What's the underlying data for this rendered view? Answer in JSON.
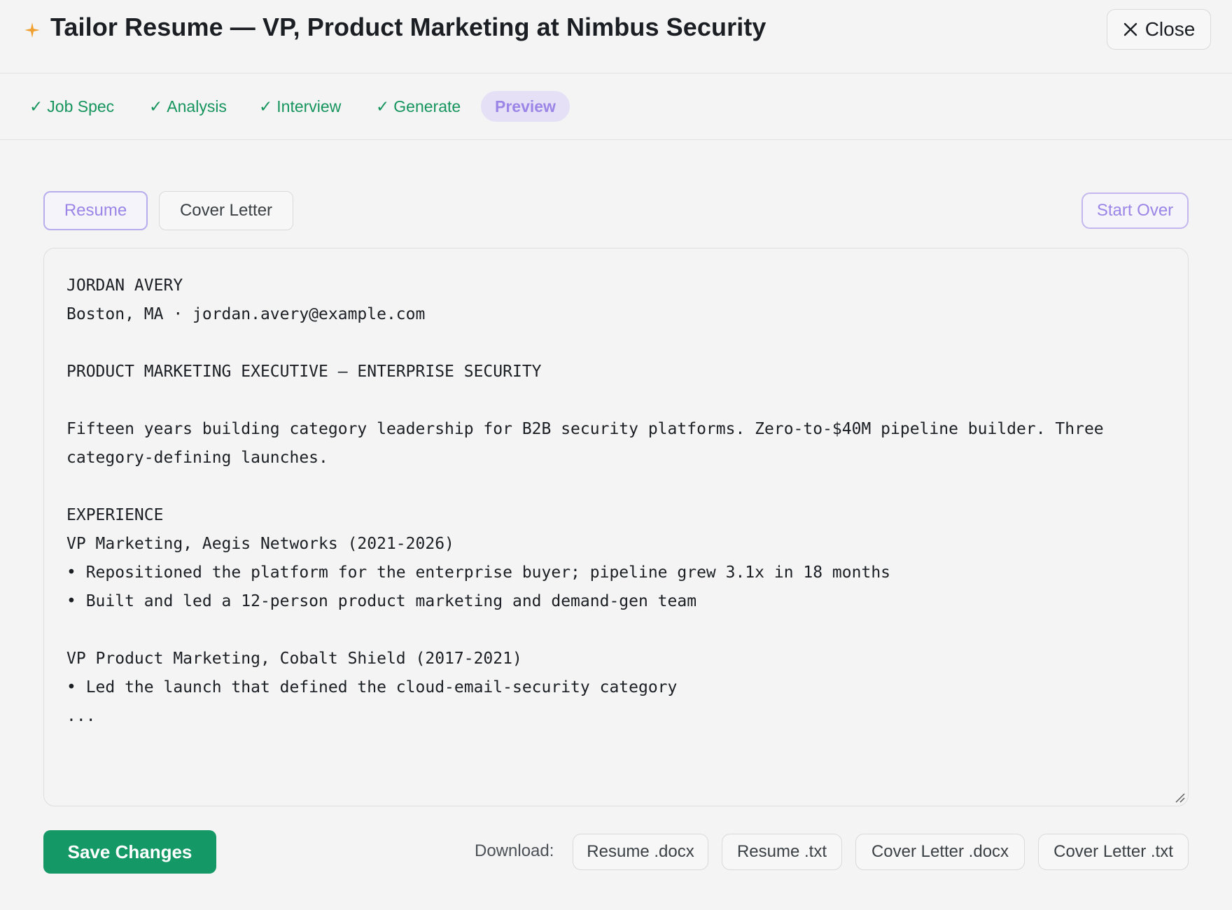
{
  "header": {
    "title": "Tailor Resume — VP, Product Marketing at Nimbus Security",
    "close_label": "Close"
  },
  "steps": [
    {
      "label": "Job Spec",
      "status": "done"
    },
    {
      "label": "Analysis",
      "status": "done"
    },
    {
      "label": "Interview",
      "status": "done"
    },
    {
      "label": "Generate",
      "status": "done"
    },
    {
      "label": "Preview",
      "status": "active"
    }
  ],
  "step_check": "✓",
  "tabs": {
    "resume": "Resume",
    "cover_letter": "Cover Letter",
    "active": "Resume"
  },
  "start_over_label": "Start Over",
  "editor": {
    "lines": [
      "JORDAN AVERY",
      "Boston, MA · jordan.avery@example.com",
      "",
      "PRODUCT MARKETING EXECUTIVE — ENTERPRISE SECURITY",
      "",
      "Fifteen years building category leadership for B2B security platforms. Zero-to-$40M pipeline builder. Three",
      "category-defining launches.",
      "",
      "EXPERIENCE",
      "VP Marketing, Aegis Networks (2021-2026)",
      "• Repositioned the platform for the enterprise buyer; pipeline grew 3.1x in 18 months",
      "• Built and led a 12-person product marketing and demand-gen team",
      "",
      "VP Product Marketing, Cobalt Shield (2017-2021)",
      "• Led the launch that defined the cloud-email-security category",
      "..."
    ]
  },
  "footer": {
    "save_label": "Save Changes",
    "download_label": "Download:",
    "downloads": [
      "Resume .docx",
      "Resume .txt",
      "Cover Letter .docx",
      "Cover Letter .txt"
    ]
  },
  "colors": {
    "accent_purple": "#9b85e6",
    "success_green": "#139866",
    "spark_orange": "#f0a030"
  }
}
